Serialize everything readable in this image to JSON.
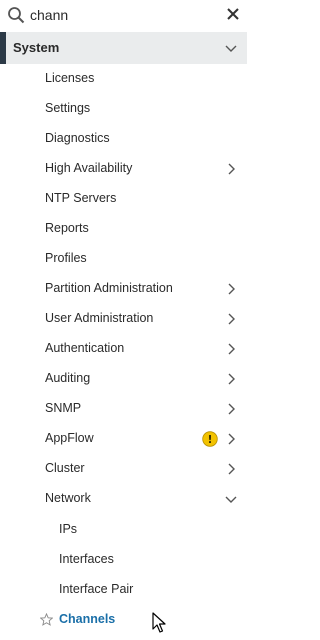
{
  "search": {
    "value": "chann",
    "placeholder": ""
  },
  "section": {
    "label": "System"
  },
  "items": [
    {
      "label": "Licenses",
      "has_children": false
    },
    {
      "label": "Settings",
      "has_children": false
    },
    {
      "label": "Diagnostics",
      "has_children": false
    },
    {
      "label": "High Availability",
      "has_children": true
    },
    {
      "label": "NTP Servers",
      "has_children": false
    },
    {
      "label": "Reports",
      "has_children": false
    },
    {
      "label": "Profiles",
      "has_children": false
    },
    {
      "label": "Partition Administration",
      "has_children": true
    },
    {
      "label": "User Administration",
      "has_children": true
    },
    {
      "label": "Authentication",
      "has_children": true
    },
    {
      "label": "Auditing",
      "has_children": true
    },
    {
      "label": "SNMP",
      "has_children": true
    },
    {
      "label": "AppFlow",
      "has_children": true,
      "badge": "warning-icon"
    },
    {
      "label": "Cluster",
      "has_children": true
    },
    {
      "label": "Network",
      "has_children": true,
      "expanded": true
    }
  ],
  "network_children": [
    {
      "label": "IPs"
    },
    {
      "label": "Interfaces"
    },
    {
      "label": "Interface Pair"
    },
    {
      "label": "Channels",
      "highlighted": true,
      "icon": "star-icon"
    }
  ],
  "colors": {
    "accent_bar": "#2c3a47",
    "section_bg": "#eaeced",
    "link_blue": "#1a6fa8",
    "warning_yellow": "#f2c200"
  }
}
